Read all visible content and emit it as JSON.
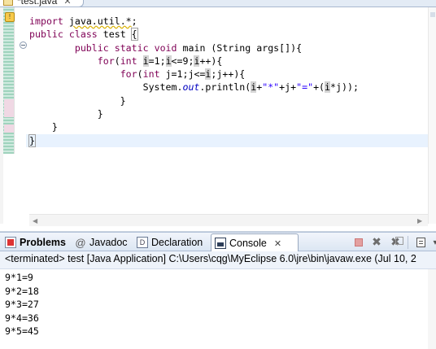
{
  "editor": {
    "tab_label": "*test.java",
    "tab_close": "✕",
    "lines": [
      {
        "segments": [
          {
            "t": "import ",
            "c": "kw"
          },
          {
            "t": "java.util.*",
            "c": "squig"
          },
          {
            "t": ";",
            "c": ""
          }
        ]
      },
      {
        "segments": [
          {
            "t": "public ",
            "c": "kw"
          },
          {
            "t": "class ",
            "c": "kw"
          },
          {
            "t": "test ",
            "c": ""
          },
          {
            "t": "{",
            "c": "brace-box"
          }
        ]
      },
      {
        "segments": [
          {
            "t": "        ",
            "c": ""
          },
          {
            "t": "public ",
            "c": "kw"
          },
          {
            "t": "static ",
            "c": "kw"
          },
          {
            "t": "void ",
            "c": "kw"
          },
          {
            "t": "main (String args[]){",
            "c": ""
          }
        ]
      },
      {
        "segments": [
          {
            "t": "            ",
            "c": ""
          },
          {
            "t": "for",
            "c": "kw"
          },
          {
            "t": "(",
            "c": ""
          },
          {
            "t": "int ",
            "c": "kw"
          },
          {
            "t": "i",
            "c": "hl"
          },
          {
            "t": "=1;",
            "c": ""
          },
          {
            "t": "i",
            "c": "hl"
          },
          {
            "t": "<=9;",
            "c": ""
          },
          {
            "t": "i",
            "c": "hl"
          },
          {
            "t": "++){",
            "c": ""
          }
        ]
      },
      {
        "segments": [
          {
            "t": "                ",
            "c": ""
          },
          {
            "t": "for",
            "c": "kw"
          },
          {
            "t": "(",
            "c": ""
          },
          {
            "t": "int ",
            "c": "kw"
          },
          {
            "t": "j=1;j<=",
            "c": ""
          },
          {
            "t": "i",
            "c": "hl"
          },
          {
            "t": ";j++){",
            "c": ""
          }
        ]
      },
      {
        "segments": [
          {
            "t": "                    System.",
            "c": ""
          },
          {
            "t": "out",
            "c": "fld"
          },
          {
            "t": ".println(",
            "c": ""
          },
          {
            "t": "i",
            "c": "hl"
          },
          {
            "t": "+",
            "c": ""
          },
          {
            "t": "\"*\"",
            "c": "str"
          },
          {
            "t": "+j+",
            "c": ""
          },
          {
            "t": "\"=\"",
            "c": "str"
          },
          {
            "t": "+(",
            "c": ""
          },
          {
            "t": "i",
            "c": "hl"
          },
          {
            "t": "*j));",
            "c": ""
          }
        ]
      },
      {
        "segments": [
          {
            "t": "                }",
            "c": ""
          }
        ]
      },
      {
        "segments": [
          {
            "t": "            }",
            "c": ""
          }
        ]
      },
      {
        "segments": [
          {
            "t": "    }",
            "c": ""
          }
        ]
      },
      {
        "segments": [
          {
            "t": "}",
            "c": "brace-box"
          }
        ],
        "current": true,
        "caret": true
      }
    ]
  },
  "views": {
    "problems_label": "Problems",
    "javadoc_label": "Javadoc",
    "javadoc_icon": "@",
    "declaration_label": "Declaration",
    "declaration_icon": "D",
    "console_label": "Console",
    "console_close": "✕",
    "remove_icon": "✖",
    "remove_all_icon": "✖",
    "more_icon": "▾"
  },
  "console": {
    "header": "<terminated> test [Java Application] C:\\Users\\cqg\\MyEclipse 6.0\\jre\\bin\\javaw.exe (Jul 10, 2",
    "output": [
      "9*1=9",
      "9*2=18",
      "9*3=27",
      "9*4=36",
      "9*5=45"
    ]
  },
  "icons": {
    "warning": "warning-icon",
    "fold": "collapse-icon",
    "java_file": "java-file-icon"
  },
  "colors": {
    "keyword": "#7f0055",
    "string": "#2a00ff",
    "field": "#0000c0",
    "current_line": "#e8f2fe",
    "occurrence_highlight": "#d4d4d4"
  }
}
